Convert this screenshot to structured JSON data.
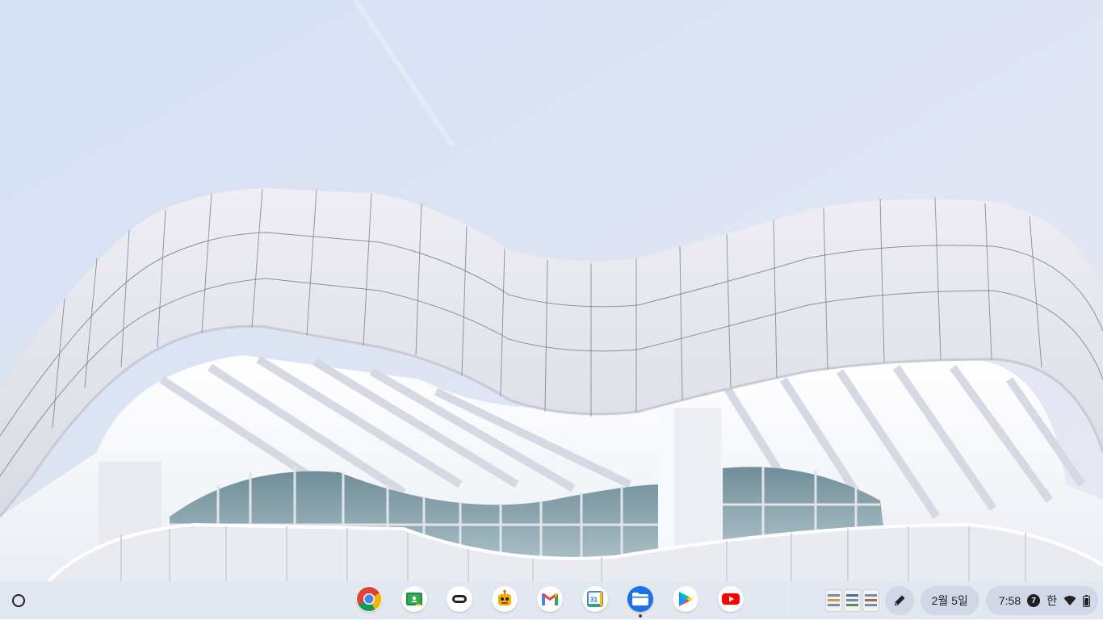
{
  "wallpaper": {
    "description_icon": "building-wallpaper"
  },
  "shelf": {
    "launcher_icon": "launcher-circle-icon",
    "apps": [
      {
        "name": "chrome",
        "icon": "chrome-icon"
      },
      {
        "name": "classroom",
        "icon": "classroom-icon"
      },
      {
        "name": "gamepad-app",
        "icon": "gamepad-icon"
      },
      {
        "name": "robot-app",
        "icon": "robot-icon"
      },
      {
        "name": "gmail",
        "icon": "gmail-icon"
      },
      {
        "name": "calendar",
        "icon": "calendar-icon",
        "badge_text": "31"
      },
      {
        "name": "files",
        "icon": "files-icon",
        "running": true
      },
      {
        "name": "play-store",
        "icon": "play-store-icon"
      },
      {
        "name": "youtube",
        "icon": "youtube-icon"
      }
    ],
    "tray": {
      "date": "2월 5일",
      "time": "7:58",
      "notification_count": "7",
      "ime": "한"
    }
  },
  "colors": {
    "sky": "#dfe6f3",
    "shelf": "#e2e6f0",
    "files_blue": "#1a73e8",
    "youtube_red": "#ff0000"
  }
}
